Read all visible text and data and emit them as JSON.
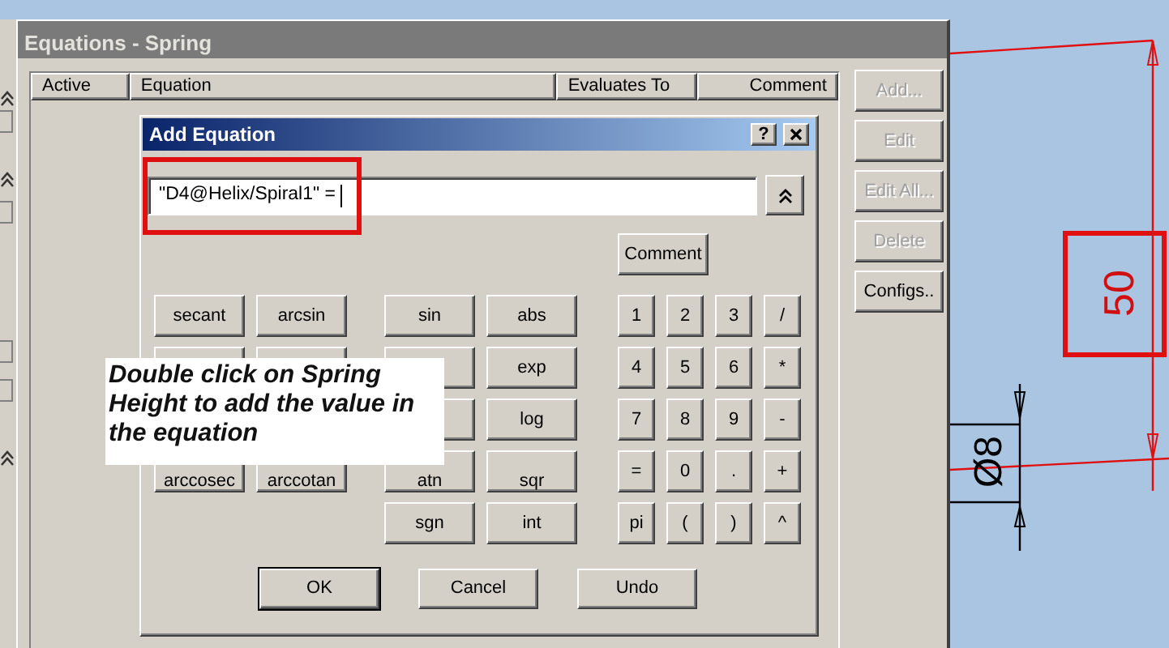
{
  "outer_window": {
    "title": "Equations - Spring",
    "active": false
  },
  "table": {
    "columns": [
      "Active",
      "Equation",
      "Evaluates To",
      "Comment"
    ]
  },
  "side_buttons": [
    {
      "label": "Add...",
      "disabled": true
    },
    {
      "label": "Edit",
      "disabled": true
    },
    {
      "label": "Edit All...",
      "disabled": true
    },
    {
      "label": "Delete",
      "disabled": true
    },
    {
      "label": "Configs..",
      "disabled": false
    }
  ],
  "dialog": {
    "title": "Add Equation",
    "help_button": "?",
    "equation": {
      "value": "\"D4@Helix/Spiral1\" = ",
      "highlighted": true
    },
    "comment_button": "Comment",
    "function_buttons_left": [
      {
        "kind": "labeled",
        "label": "secant"
      },
      {
        "kind": "labeled",
        "label": "arcsin"
      },
      {
        "kind": "blank"
      },
      {
        "kind": "blank"
      },
      {
        "kind": "labeled",
        "label": "arccosec"
      },
      {
        "kind": "labeled",
        "label": "arccotan"
      }
    ],
    "function_buttons_right": [
      {
        "kind": "labeled",
        "label": "sin"
      },
      {
        "kind": "labeled",
        "label": "abs"
      },
      {
        "kind": "blank"
      },
      {
        "kind": "labeled",
        "label": "exp"
      },
      {
        "kind": "blank"
      },
      {
        "kind": "labeled",
        "label": "log"
      },
      {
        "kind": "labeled",
        "label": "atn"
      },
      {
        "kind": "labeled",
        "label": "sqr"
      },
      {
        "kind": "labeled",
        "label": "sgn"
      },
      {
        "kind": "labeled",
        "label": "int"
      }
    ],
    "keypad": [
      "1",
      "2",
      "3",
      "/",
      "4",
      "5",
      "6",
      "*",
      "7",
      "8",
      "9",
      "-",
      "=",
      "0",
      ".",
      "+",
      "pi",
      "(",
      ")",
      "^"
    ],
    "action_buttons": [
      {
        "label": "OK",
        "default": true
      },
      {
        "label": "Cancel",
        "default": false
      },
      {
        "label": "Undo",
        "default": false
      }
    ]
  },
  "note": "Double click on Spring Height to add the value in the equation",
  "drawing": {
    "height_dimension": "50",
    "highlighted": true,
    "diameter_dimension": "Ø8"
  }
}
